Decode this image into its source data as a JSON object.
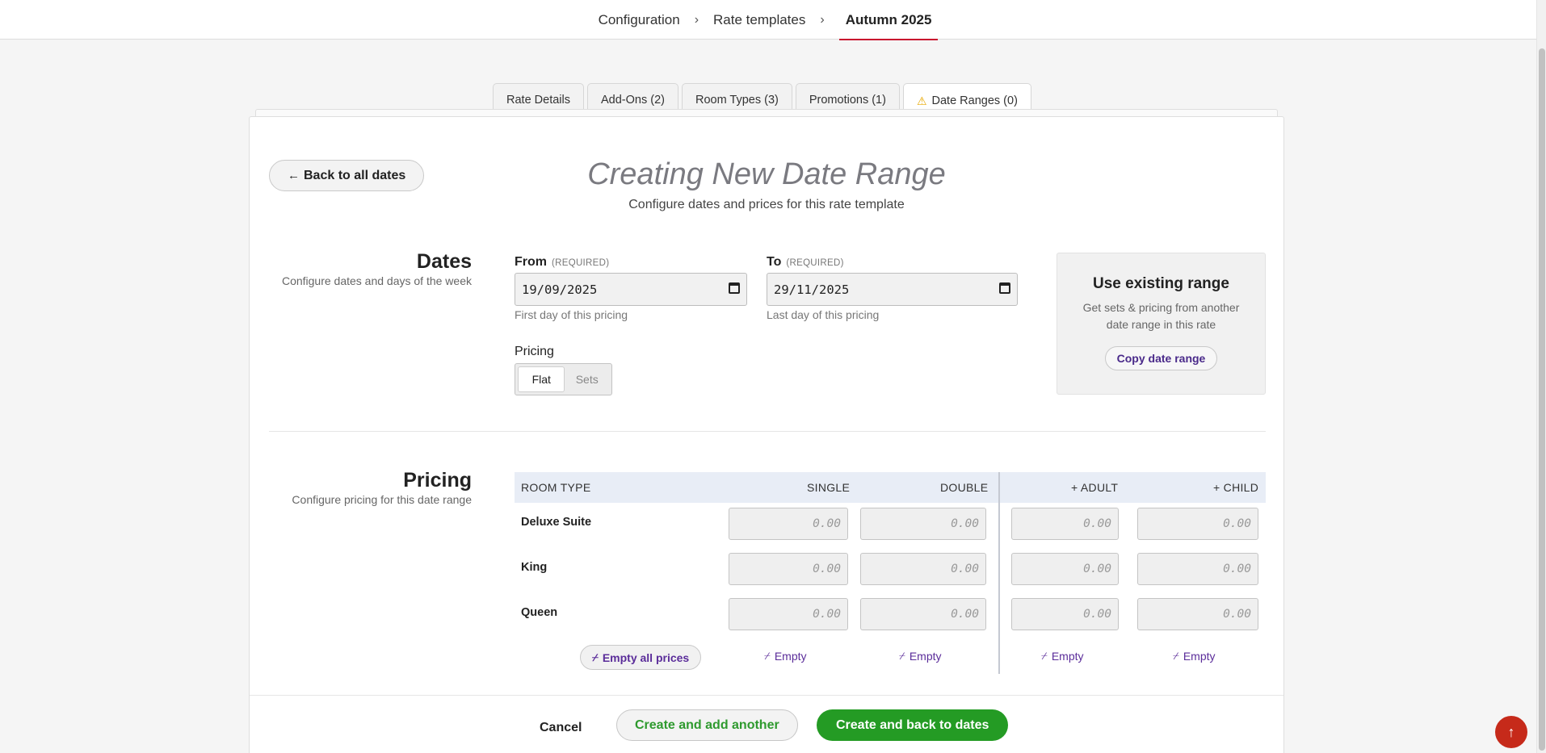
{
  "breadcrumb": {
    "items": [
      "Configuration",
      "Rate templates"
    ],
    "current": "Autumn 2025",
    "separator": "›"
  },
  "tabs": [
    {
      "label": "Rate Details",
      "active": false
    },
    {
      "label": "Add-Ons (2)",
      "active": false
    },
    {
      "label": "Room Types (3)",
      "active": false
    },
    {
      "label": "Promotions (1)",
      "active": false
    },
    {
      "label": "Date Ranges (0)",
      "active": true,
      "icon": "warning-icon"
    }
  ],
  "header": {
    "back_label": "Back to all dates",
    "title": "Creating New Date Range",
    "subtitle": "Configure dates and prices for this rate template"
  },
  "dates": {
    "title": "Dates",
    "description": "Configure dates and days of the week",
    "from": {
      "label": "From",
      "required": "(REQUIRED)",
      "value": "19/09/2025",
      "hint": "First day of this pricing"
    },
    "to": {
      "label": "To",
      "required": "(REQUIRED)",
      "value": "29/11/2025",
      "hint": "Last day of this pricing"
    },
    "pricing_label": "Pricing",
    "pricing_options": [
      "Flat",
      "Sets"
    ],
    "pricing_selected": "Flat"
  },
  "existing_range": {
    "title": "Use existing range",
    "description": "Get sets & pricing from another date range in this rate",
    "button": "Copy date range"
  },
  "pricing": {
    "title": "Pricing",
    "description": "Configure pricing for this date range",
    "columns": [
      "ROOM TYPE",
      "SINGLE",
      "DOUBLE",
      "+ ADULT",
      "+ CHILD"
    ],
    "rows": [
      {
        "name": "Deluxe Suite",
        "single": "0.00",
        "double": "0.00",
        "adult": "0.00",
        "child": "0.00"
      },
      {
        "name": "King",
        "single": "0.00",
        "double": "0.00",
        "adult": "0.00",
        "child": "0.00"
      },
      {
        "name": "Queen",
        "single": "0.00",
        "double": "0.00",
        "adult": "0.00",
        "child": "0.00"
      }
    ],
    "empty_all_label": "Empty all prices",
    "empty_label": "Empty"
  },
  "footer": {
    "cancel": "Cancel",
    "create_add_another": "Create and add another",
    "create_back": "Create and back to dates"
  },
  "colors": {
    "accent_red": "#c8102e",
    "primary_green": "#249b24",
    "link_purple": "#5b2d9a"
  }
}
